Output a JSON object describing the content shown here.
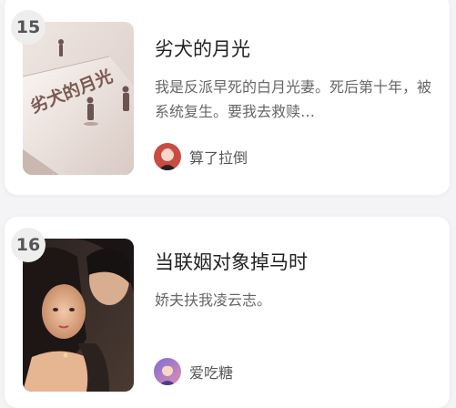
{
  "books": [
    {
      "rank": "15",
      "title": "劣犬的月光",
      "description": "我是反派早死的白月光妻。死后第十年，被系统复生。要我去救赎…",
      "author": "算了拉倒"
    },
    {
      "rank": "16",
      "title": "当联姻对象掉马时",
      "description": "娇夫扶我凌云志。",
      "author": "爱吃糖"
    }
  ]
}
